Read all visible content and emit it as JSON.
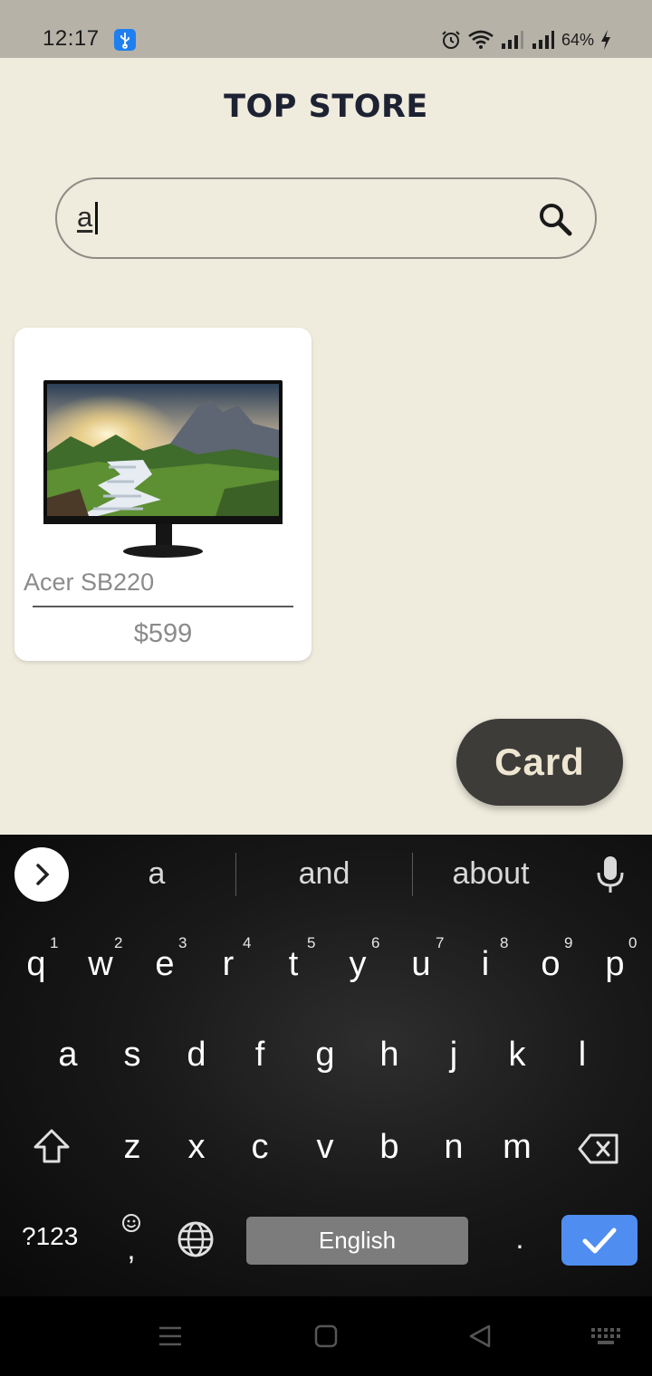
{
  "status_bar": {
    "time": "12:17",
    "battery": "64%",
    "icons": [
      "usb-icon",
      "alarm-icon",
      "wifi-icon",
      "signal-icon",
      "signal-icon",
      "charging-icon"
    ]
  },
  "app": {
    "title": "TOP STORE",
    "search": {
      "value": "a",
      "icon": "search-icon"
    },
    "products": [
      {
        "name": "Acer SB220",
        "price": "$599",
        "image": "monitor-image"
      }
    ],
    "card_button": "Card"
  },
  "keyboard": {
    "suggestions": [
      "a",
      "and",
      "about"
    ],
    "row1": [
      "q",
      "w",
      "e",
      "r",
      "t",
      "y",
      "u",
      "i",
      "o",
      "p"
    ],
    "row1_hints": [
      "1",
      "2",
      "3",
      "4",
      "5",
      "6",
      "7",
      "8",
      "9",
      "0"
    ],
    "row2": [
      "a",
      "s",
      "d",
      "f",
      "g",
      "h",
      "j",
      "k",
      "l"
    ],
    "row3": [
      "z",
      "x",
      "c",
      "v",
      "b",
      "n",
      "m"
    ],
    "mode_key": "?123",
    "emoji_comma": ",",
    "space_label": "English",
    "period": ".",
    "enter_color": "#4f8ef0"
  },
  "colors": {
    "background": "#efebdd",
    "title": "#1d2233",
    "card_button_bg": "#3d3c39",
    "card_button_text": "#eee6d1"
  }
}
